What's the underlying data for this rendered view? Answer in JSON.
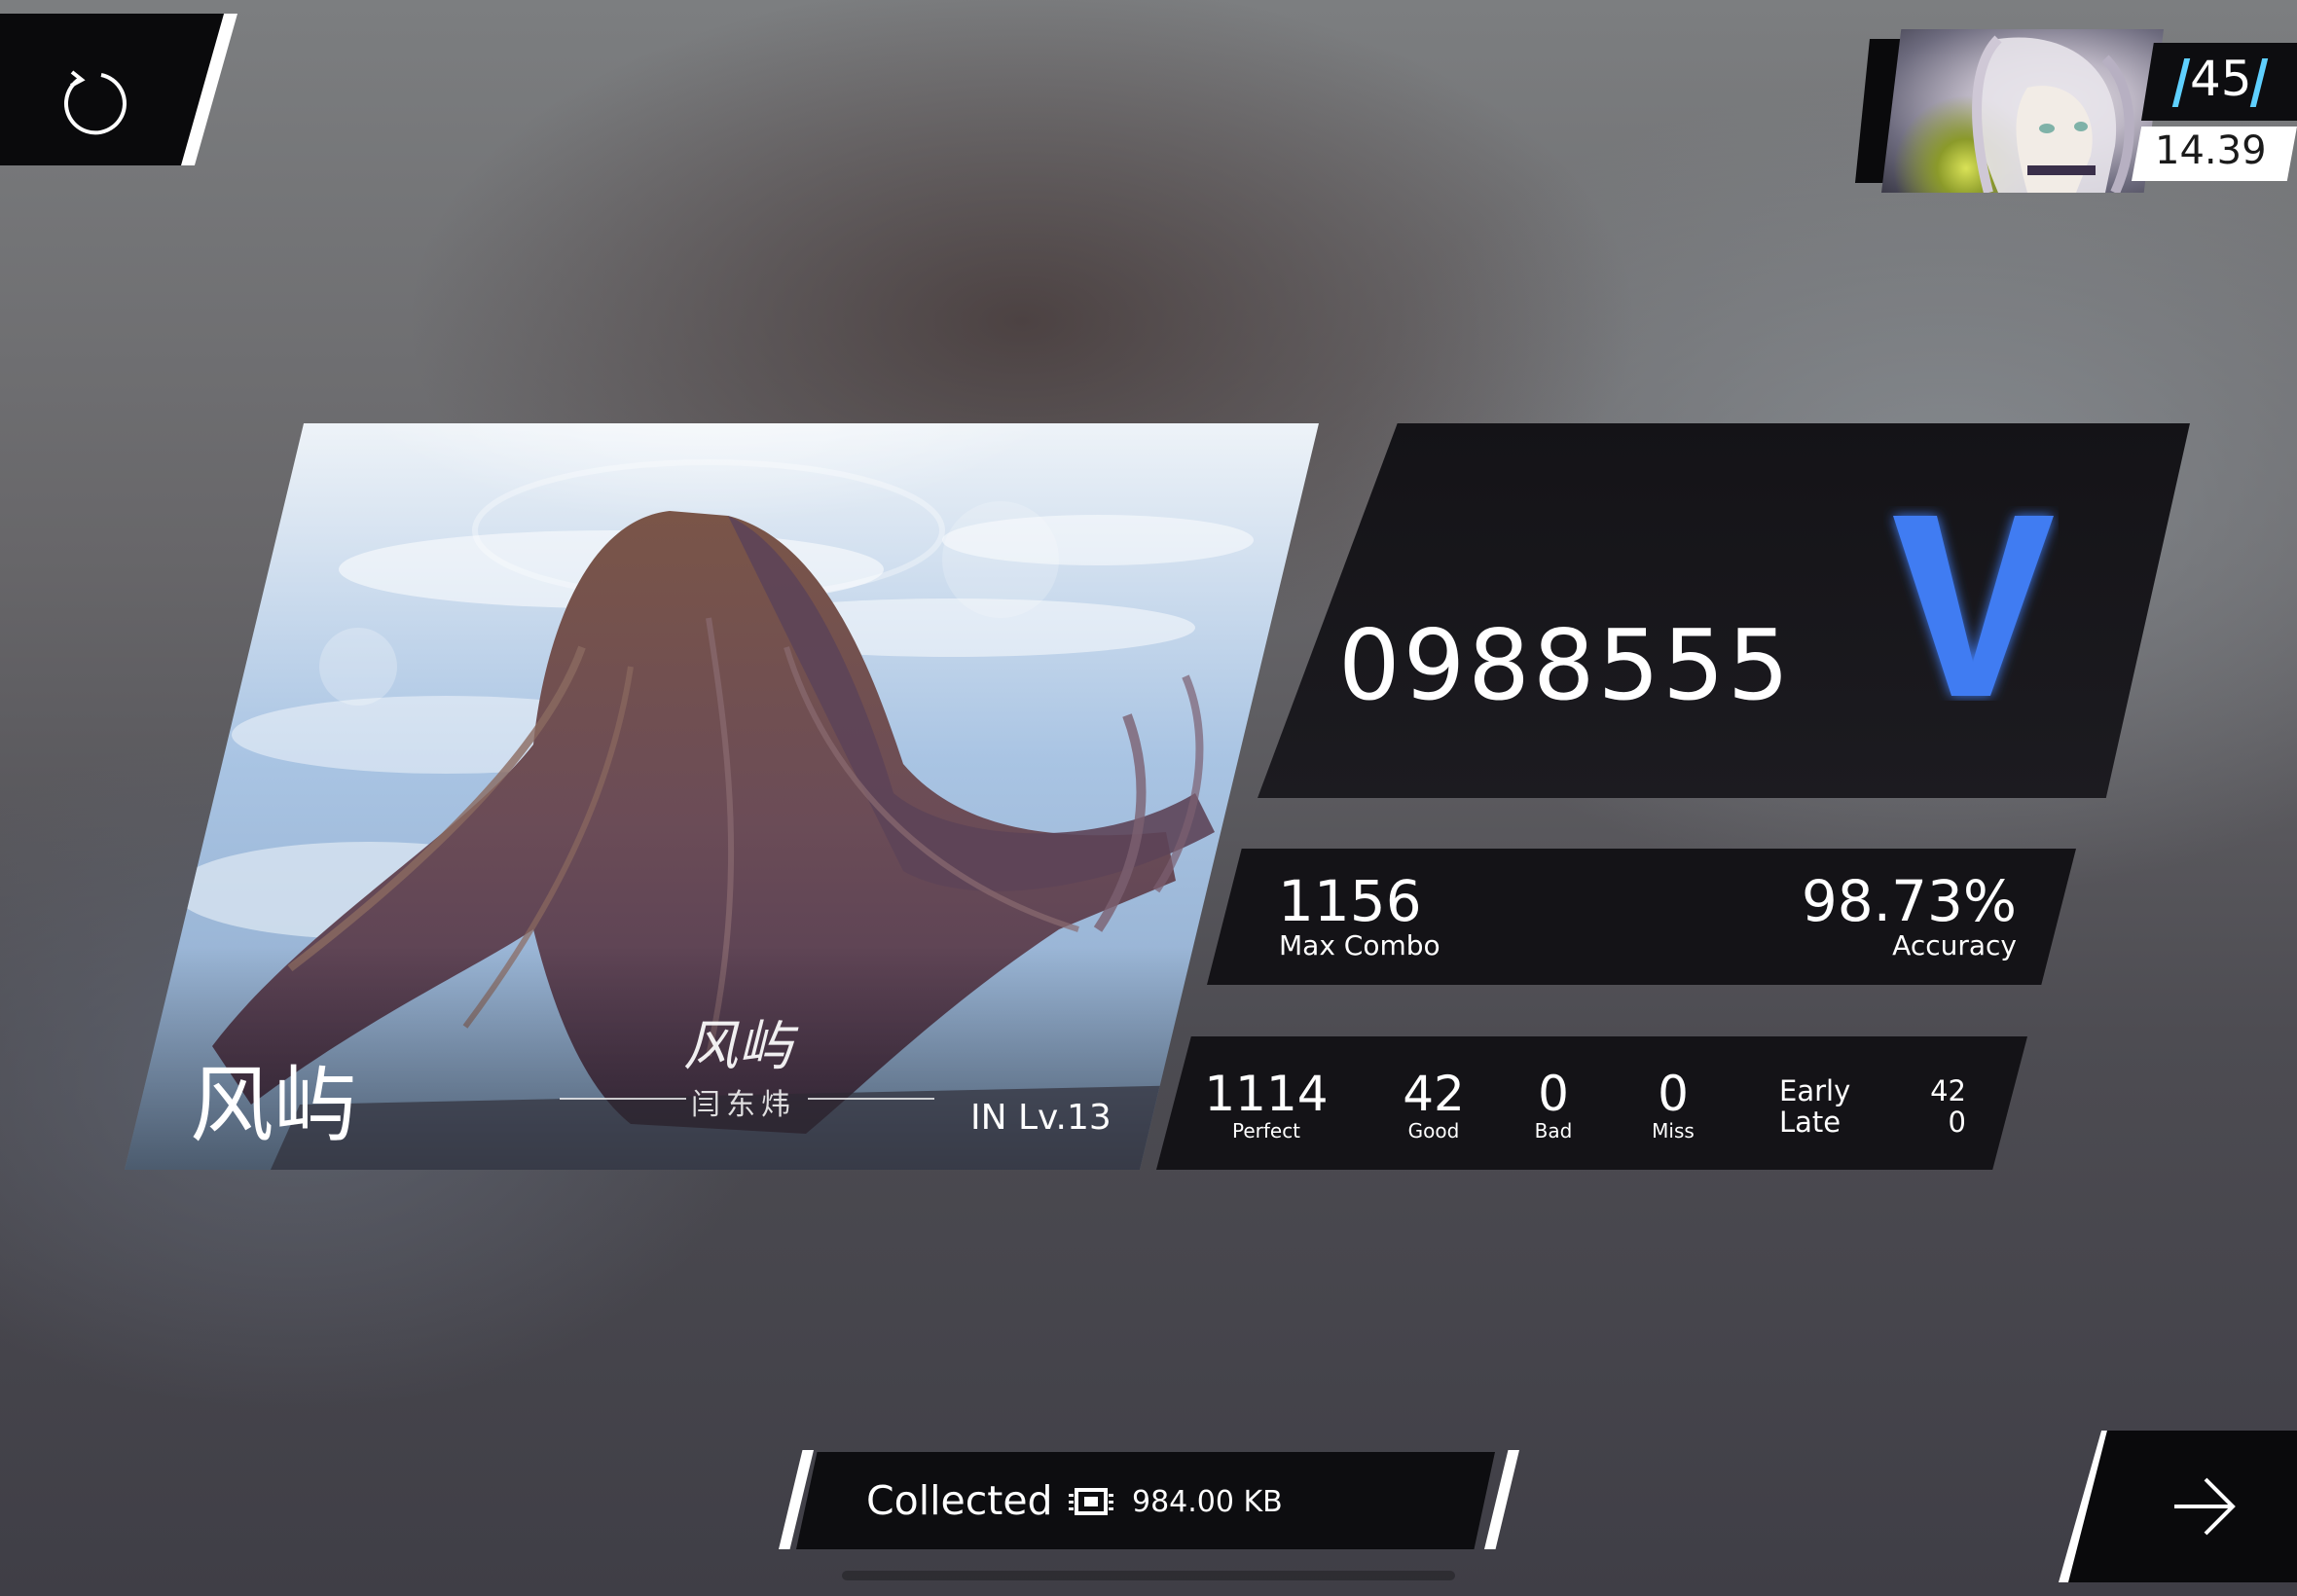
{
  "player": {
    "rks": "45",
    "level": "14.39"
  },
  "song": {
    "title": "风屿",
    "logo_text": "风屿",
    "artist": "闫东炜",
    "difficulty": "IN Lv.13"
  },
  "result": {
    "score": "0988555",
    "grade": "V",
    "grade_color": "#3f7cf2",
    "max_combo": "1156",
    "max_combo_label": "Max Combo",
    "accuracy": "98.73%",
    "accuracy_label": "Accuracy"
  },
  "judgements": [
    {
      "value": "1114",
      "label": "Perfect"
    },
    {
      "value": "42",
      "label": "Good"
    },
    {
      "value": "0",
      "label": "Bad"
    },
    {
      "value": "0",
      "label": "Miss"
    }
  ],
  "timing": {
    "early_label": "Early",
    "early_value": "42",
    "late_label": "Late",
    "late_value": "0"
  },
  "collected": {
    "label": "Collected",
    "icon": "chip-icon",
    "size": "984.00 KB"
  },
  "icons": {
    "retry": "retry-icon",
    "next": "arrow-right-icon"
  }
}
